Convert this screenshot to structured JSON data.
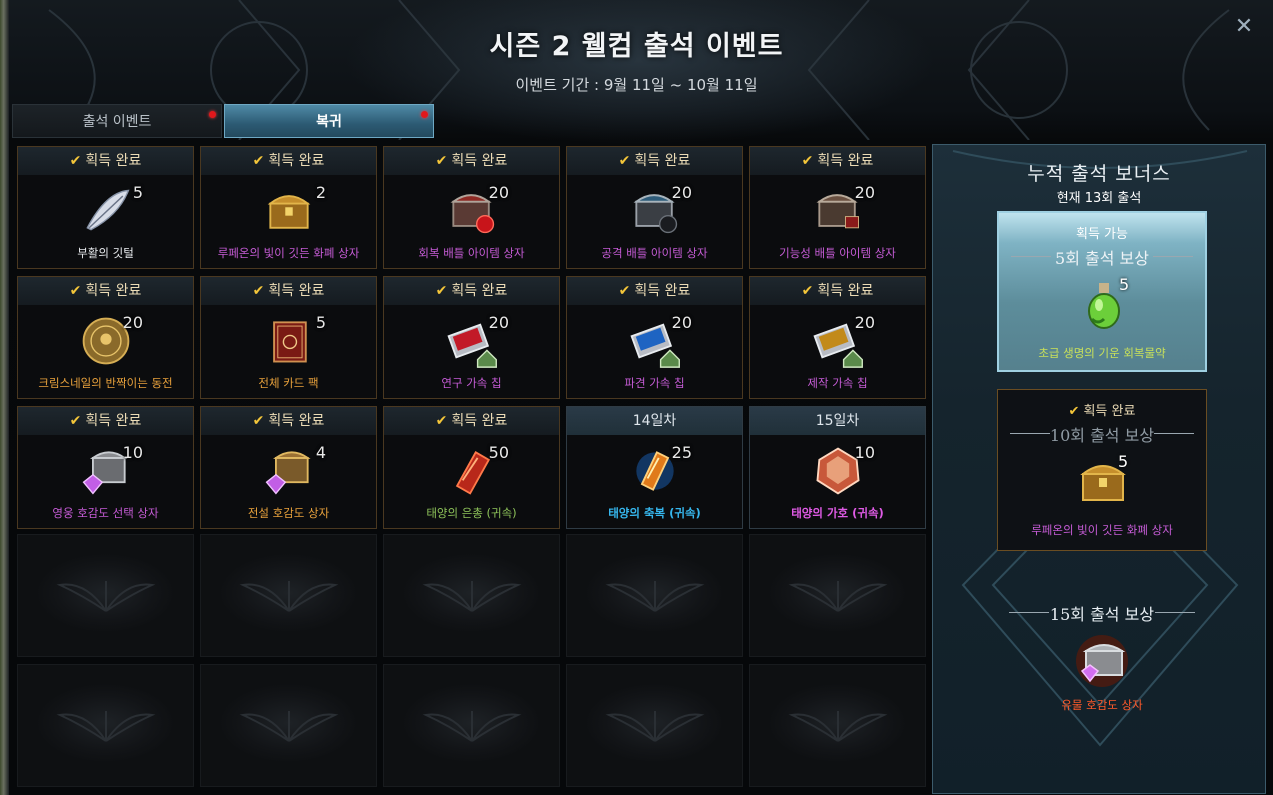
{
  "window": {
    "title": "시즌 2 웰컴 출석 이벤트",
    "period": "이벤트 기간 : 9월 11일 ~ 10월 11일",
    "close_symbol": "✕"
  },
  "tabs": [
    {
      "label": "출석 이벤트",
      "active": false,
      "has_notification": true
    },
    {
      "label": "복귀",
      "active": true,
      "has_notification": true
    }
  ],
  "claimed_label": "획득 완료",
  "check_symbol": "✔",
  "rewards": [
    {
      "state": "획득 완료",
      "count": "5",
      "name": "부활의 깃털",
      "icon": "feather-icon",
      "name_color": "#e9ecef"
    },
    {
      "state": "획득 완료",
      "count": "2",
      "name": "루페온의 빛이 깃든 화폐 상자",
      "icon": "gold-chest-icon",
      "name_color": "#c65cd6"
    },
    {
      "state": "획득 완료",
      "count": "20",
      "name": "회복 배틀 아이템 상자",
      "icon": "red-chest-icon",
      "name_color": "#c65cd6"
    },
    {
      "state": "획득 완료",
      "count": "20",
      "name": "공격 배틀 아이템 상자",
      "icon": "blue-chest-icon",
      "name_color": "#c65cd6"
    },
    {
      "state": "획득 완료",
      "count": "20",
      "name": "기능성 배틀 아이템 상자",
      "icon": "brown-chest-icon",
      "name_color": "#c65cd6"
    },
    {
      "state": "획득 완료",
      "count": "20",
      "name": "크림스네일의 반짝이는 동전",
      "icon": "coin-icon",
      "name_color": "#e9a23c"
    },
    {
      "state": "획득 완료",
      "count": "5",
      "name": "전체 카드 팩",
      "icon": "card-pack-icon",
      "name_color": "#e9a23c"
    },
    {
      "state": "획득 완료",
      "count": "20",
      "name": "연구 가속 칩",
      "icon": "research-chip-icon",
      "name_color": "#c65cd6"
    },
    {
      "state": "획득 완료",
      "count": "20",
      "name": "파견 가속 칩",
      "icon": "dispatch-chip-icon",
      "name_color": "#c65cd6"
    },
    {
      "state": "획득 완료",
      "count": "20",
      "name": "제작 가속 칩",
      "icon": "craft-chip-icon",
      "name_color": "#c65cd6"
    },
    {
      "state": "획득 완료",
      "count": "10",
      "name": "영웅 호감도 선택 상자",
      "icon": "heart-chest-icon",
      "name_color": "#c65cd6"
    },
    {
      "state": "획득 완료",
      "count": "4",
      "name": "전설 호감도 상자",
      "icon": "legend-heart-chest-icon",
      "name_color": "#e9a23c"
    },
    {
      "state": "획득 완료",
      "count": "50",
      "name": "태양의 은총 (귀속)",
      "icon": "sun-grace-icon",
      "name_color": "#8ec35a"
    },
    {
      "state": "14일차",
      "count": "25",
      "name": "태양의 축복 (귀속)",
      "icon": "sun-blessing-icon",
      "name_color": "#36b7ee"
    },
    {
      "state": "15일차",
      "count": "10",
      "name": "태양의 가호 (귀속)",
      "icon": "sun-protection-icon",
      "name_color": "#e05be6"
    }
  ],
  "bonus": {
    "title": "누적 출석 보너스",
    "current": "현재 13회 출석",
    "tiers": [
      {
        "state": "획득 가능",
        "label": "5회 출석 보상",
        "count": "5",
        "name": "초급 생명의 기운 회복물약",
        "icon": "potion-icon"
      },
      {
        "state": "획득 완료",
        "label": "10회 출석 보상",
        "count": "5",
        "name": "루페온의 빛이 깃든 화폐 상자",
        "icon": "gold-chest-icon"
      },
      {
        "state": "",
        "label": "15회 출석 보상",
        "count": "",
        "name": "유물 호감도 상자",
        "icon": "relic-heart-chest-icon"
      }
    ]
  }
}
